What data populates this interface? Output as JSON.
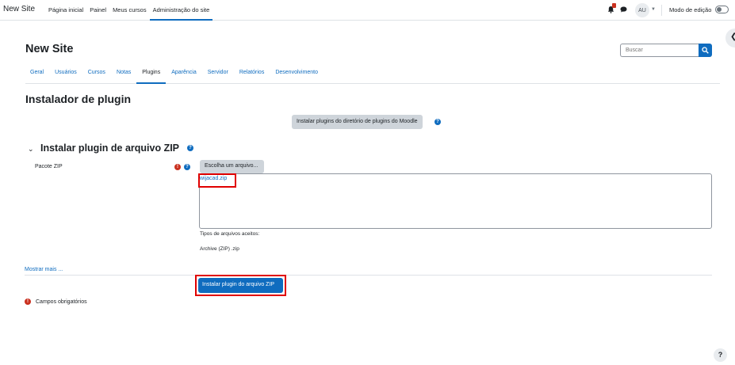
{
  "navbar": {
    "brand": "New Site",
    "links": [
      {
        "label": "Página inicial",
        "active": false
      },
      {
        "label": "Painel",
        "active": false
      },
      {
        "label": "Meus cursos",
        "active": false
      },
      {
        "label": "Administração do site",
        "active": true
      }
    ],
    "notification_icon": "bell-icon",
    "message_icon": "chat-icon",
    "avatar_initials": "AU",
    "edit_mode_label": "Modo de edição",
    "edit_mode_on": false
  },
  "header": {
    "site_title": "New Site",
    "search_placeholder": "Buscar"
  },
  "secondary_nav": [
    {
      "label": "Geral",
      "active": false
    },
    {
      "label": "Usuários",
      "active": false
    },
    {
      "label": "Cursos",
      "active": false
    },
    {
      "label": "Notas",
      "active": false
    },
    {
      "label": "Plugins",
      "active": true
    },
    {
      "label": "Aparência",
      "active": false
    },
    {
      "label": "Servidor",
      "active": false
    },
    {
      "label": "Relatórios",
      "active": false
    },
    {
      "label": "Desenvolvimento",
      "active": false
    }
  ],
  "main": {
    "heading": "Instalador de plugin",
    "directory_button": "Instalar plugins do diretório de plugins do Moodle",
    "section_title": "Instalar plugin de arquivo ZIP",
    "field_label": "Pacote ZIP",
    "choose_file_button": "Escolha um arquivo...",
    "selected_file": "wijacad.zip",
    "accepted_types_label": "Tipos de arquivos aceitos:",
    "accepted_types_value": "Archive (ZIP) .zip",
    "show_more": "Mostrar mais ...",
    "submit_button": "Instalar plugin do arquivo ZIP",
    "required_legend": "Campos obrigatórios"
  },
  "footer": {
    "help_symbol": "?"
  },
  "colors": {
    "primary": "#0f6cbf",
    "required": "#ca3120",
    "highlight": "#e00000",
    "secondary_button": "#ced4da"
  }
}
